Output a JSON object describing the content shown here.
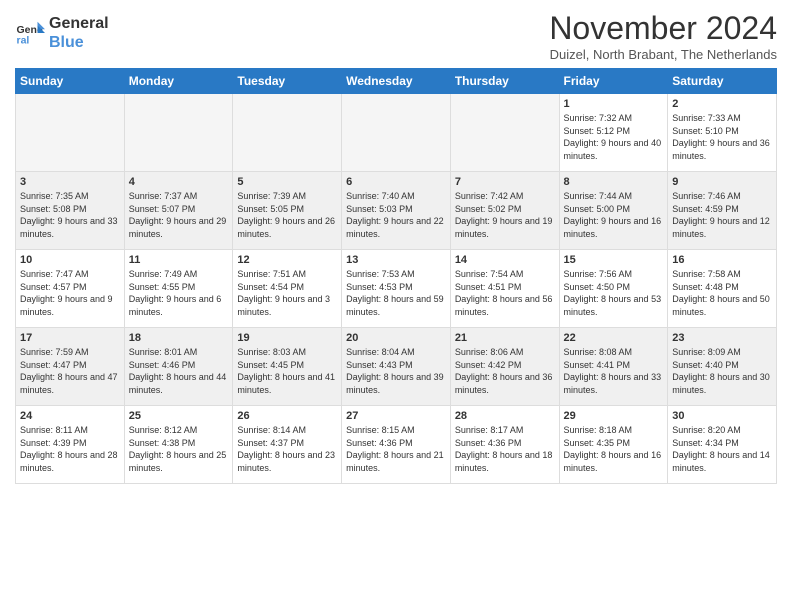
{
  "header": {
    "logo_line1": "General",
    "logo_line2": "Blue",
    "month_title": "November 2024",
    "subtitle": "Duizel, North Brabant, The Netherlands"
  },
  "weekdays": [
    "Sunday",
    "Monday",
    "Tuesday",
    "Wednesday",
    "Thursday",
    "Friday",
    "Saturday"
  ],
  "weeks": [
    [
      {
        "day": "",
        "info": ""
      },
      {
        "day": "",
        "info": ""
      },
      {
        "day": "",
        "info": ""
      },
      {
        "day": "",
        "info": ""
      },
      {
        "day": "",
        "info": ""
      },
      {
        "day": "1",
        "info": "Sunrise: 7:32 AM\nSunset: 5:12 PM\nDaylight: 9 hours and 40 minutes."
      },
      {
        "day": "2",
        "info": "Sunrise: 7:33 AM\nSunset: 5:10 PM\nDaylight: 9 hours and 36 minutes."
      }
    ],
    [
      {
        "day": "3",
        "info": "Sunrise: 7:35 AM\nSunset: 5:08 PM\nDaylight: 9 hours and 33 minutes."
      },
      {
        "day": "4",
        "info": "Sunrise: 7:37 AM\nSunset: 5:07 PM\nDaylight: 9 hours and 29 minutes."
      },
      {
        "day": "5",
        "info": "Sunrise: 7:39 AM\nSunset: 5:05 PM\nDaylight: 9 hours and 26 minutes."
      },
      {
        "day": "6",
        "info": "Sunrise: 7:40 AM\nSunset: 5:03 PM\nDaylight: 9 hours and 22 minutes."
      },
      {
        "day": "7",
        "info": "Sunrise: 7:42 AM\nSunset: 5:02 PM\nDaylight: 9 hours and 19 minutes."
      },
      {
        "day": "8",
        "info": "Sunrise: 7:44 AM\nSunset: 5:00 PM\nDaylight: 9 hours and 16 minutes."
      },
      {
        "day": "9",
        "info": "Sunrise: 7:46 AM\nSunset: 4:59 PM\nDaylight: 9 hours and 12 minutes."
      }
    ],
    [
      {
        "day": "10",
        "info": "Sunrise: 7:47 AM\nSunset: 4:57 PM\nDaylight: 9 hours and 9 minutes."
      },
      {
        "day": "11",
        "info": "Sunrise: 7:49 AM\nSunset: 4:55 PM\nDaylight: 9 hours and 6 minutes."
      },
      {
        "day": "12",
        "info": "Sunrise: 7:51 AM\nSunset: 4:54 PM\nDaylight: 9 hours and 3 minutes."
      },
      {
        "day": "13",
        "info": "Sunrise: 7:53 AM\nSunset: 4:53 PM\nDaylight: 8 hours and 59 minutes."
      },
      {
        "day": "14",
        "info": "Sunrise: 7:54 AM\nSunset: 4:51 PM\nDaylight: 8 hours and 56 minutes."
      },
      {
        "day": "15",
        "info": "Sunrise: 7:56 AM\nSunset: 4:50 PM\nDaylight: 8 hours and 53 minutes."
      },
      {
        "day": "16",
        "info": "Sunrise: 7:58 AM\nSunset: 4:48 PM\nDaylight: 8 hours and 50 minutes."
      }
    ],
    [
      {
        "day": "17",
        "info": "Sunrise: 7:59 AM\nSunset: 4:47 PM\nDaylight: 8 hours and 47 minutes."
      },
      {
        "day": "18",
        "info": "Sunrise: 8:01 AM\nSunset: 4:46 PM\nDaylight: 8 hours and 44 minutes."
      },
      {
        "day": "19",
        "info": "Sunrise: 8:03 AM\nSunset: 4:45 PM\nDaylight: 8 hours and 41 minutes."
      },
      {
        "day": "20",
        "info": "Sunrise: 8:04 AM\nSunset: 4:43 PM\nDaylight: 8 hours and 39 minutes."
      },
      {
        "day": "21",
        "info": "Sunrise: 8:06 AM\nSunset: 4:42 PM\nDaylight: 8 hours and 36 minutes."
      },
      {
        "day": "22",
        "info": "Sunrise: 8:08 AM\nSunset: 4:41 PM\nDaylight: 8 hours and 33 minutes."
      },
      {
        "day": "23",
        "info": "Sunrise: 8:09 AM\nSunset: 4:40 PM\nDaylight: 8 hours and 30 minutes."
      }
    ],
    [
      {
        "day": "24",
        "info": "Sunrise: 8:11 AM\nSunset: 4:39 PM\nDaylight: 8 hours and 28 minutes."
      },
      {
        "day": "25",
        "info": "Sunrise: 8:12 AM\nSunset: 4:38 PM\nDaylight: 8 hours and 25 minutes."
      },
      {
        "day": "26",
        "info": "Sunrise: 8:14 AM\nSunset: 4:37 PM\nDaylight: 8 hours and 23 minutes."
      },
      {
        "day": "27",
        "info": "Sunrise: 8:15 AM\nSunset: 4:36 PM\nDaylight: 8 hours and 21 minutes."
      },
      {
        "day": "28",
        "info": "Sunrise: 8:17 AM\nSunset: 4:36 PM\nDaylight: 8 hours and 18 minutes."
      },
      {
        "day": "29",
        "info": "Sunrise: 8:18 AM\nSunset: 4:35 PM\nDaylight: 8 hours and 16 minutes."
      },
      {
        "day": "30",
        "info": "Sunrise: 8:20 AM\nSunset: 4:34 PM\nDaylight: 8 hours and 14 minutes."
      }
    ]
  ],
  "colors": {
    "header_bg": "#2979c5",
    "row_odd": "#f5f5f5",
    "row_even": "#ffffff"
  }
}
